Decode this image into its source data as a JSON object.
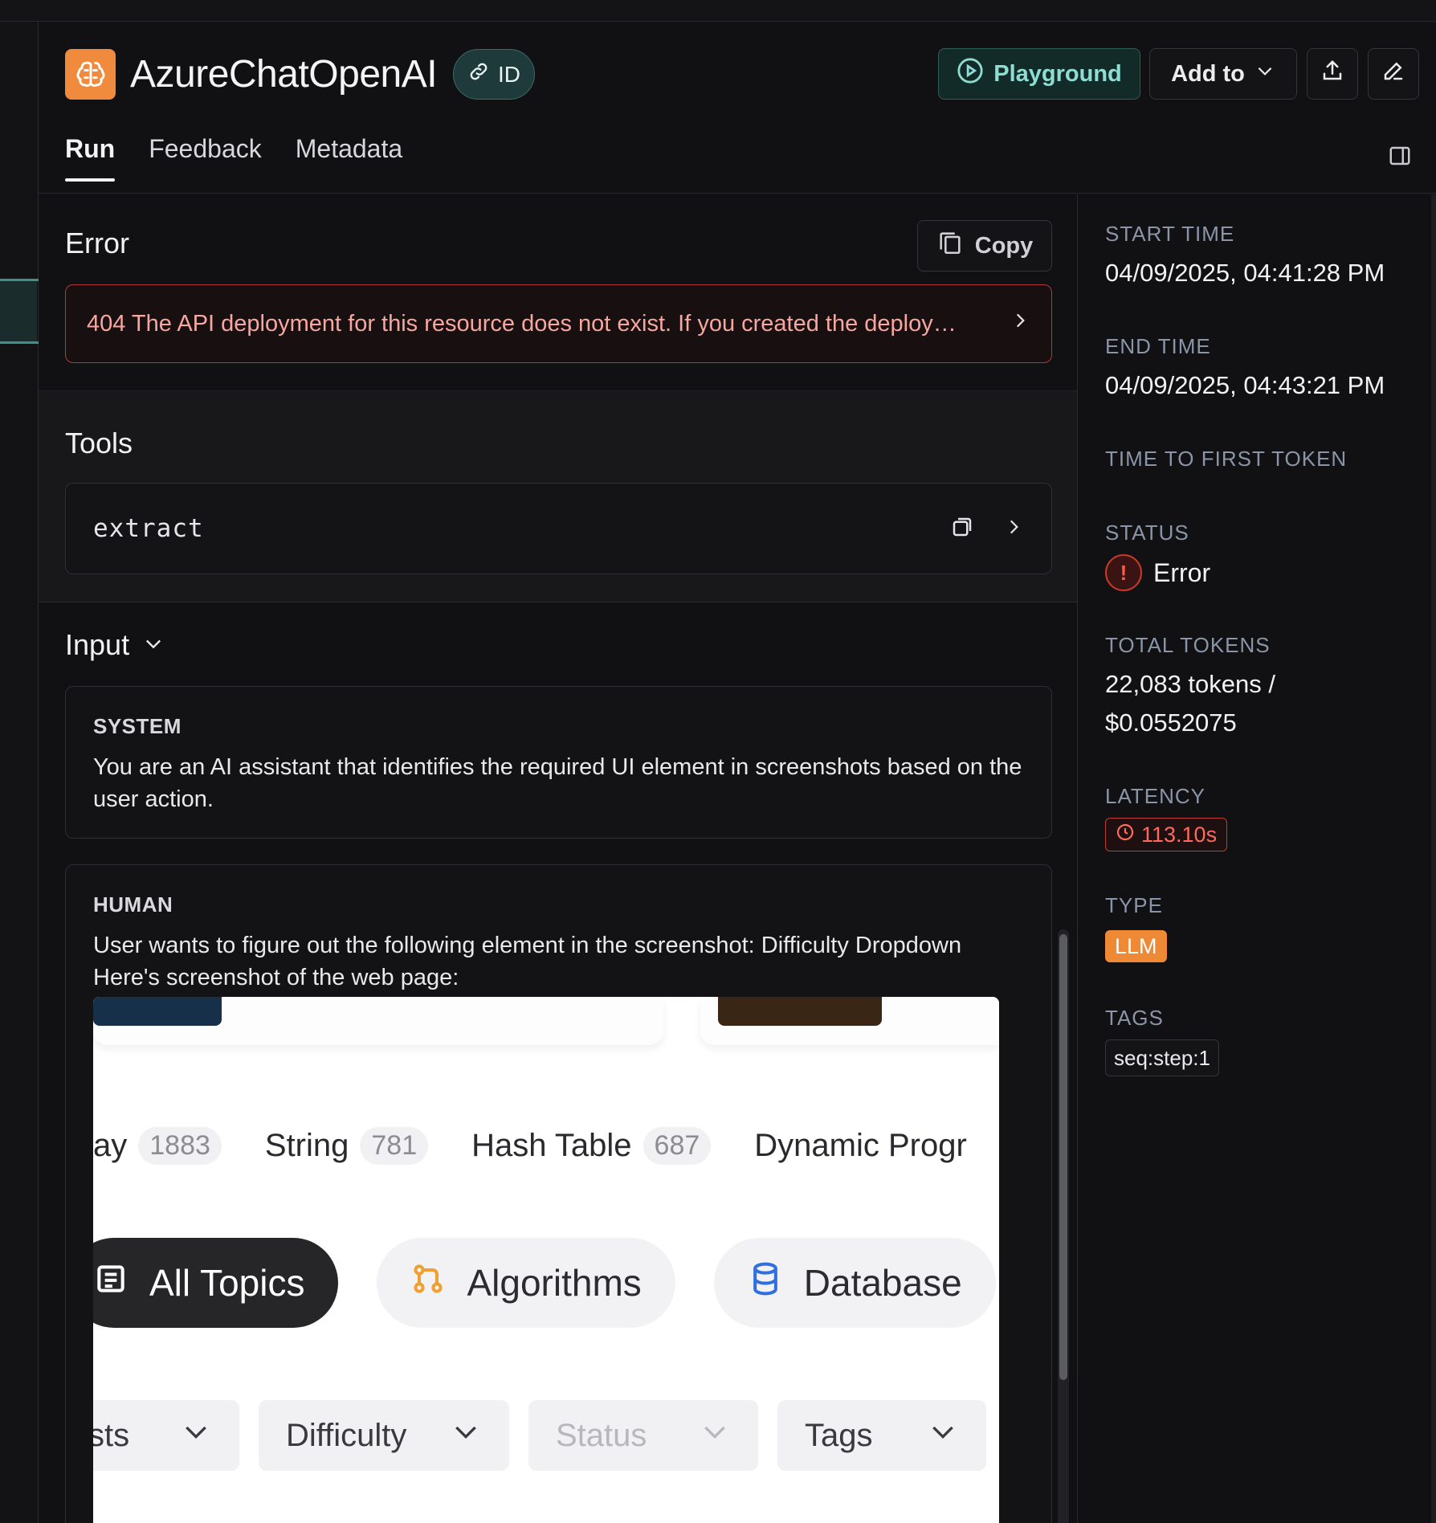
{
  "app": {
    "title": "AzureChatOpenAI",
    "id_label": "ID",
    "colors": {
      "accent": "#f08a3c",
      "teal": "#8fdcd3",
      "error": "#c9392b"
    }
  },
  "toolbar": {
    "playground_label": "Playground",
    "add_to_label": "Add to"
  },
  "tabs": [
    {
      "label": "Run",
      "active": true
    },
    {
      "label": "Feedback",
      "active": false
    },
    {
      "label": "Metadata",
      "active": false
    }
  ],
  "error_section": {
    "title": "Error",
    "copy_label": "Copy",
    "message": "404 The API deployment for this resource does not exist. If you created the deploy…"
  },
  "tools_section": {
    "title": "Tools",
    "items": [
      {
        "name": "extract"
      }
    ]
  },
  "input_section": {
    "title": "Input",
    "system": {
      "role": "SYSTEM",
      "text": "You are an AI assistant that identifies the required UI element in screenshots based on the user action."
    },
    "human": {
      "role": "HUMAN",
      "text_line1": "User wants to figure out the following element in the screenshot: Difficulty Dropdown",
      "text_line2": "Here's screenshot of the web page:",
      "screenshot": {
        "topics": [
          {
            "label": "ay",
            "count": "1883"
          },
          {
            "label": "String",
            "count": "781"
          },
          {
            "label": "Hash Table",
            "count": "687"
          },
          {
            "label": "Dynamic Progr",
            "count": ""
          }
        ],
        "pills": [
          {
            "label": "All Topics",
            "icon": "list-icon"
          },
          {
            "label": "Algorithms",
            "icon": "branch-icon"
          },
          {
            "label": "Database",
            "icon": "database-icon"
          }
        ],
        "filters": [
          {
            "label": "sts"
          },
          {
            "label": "Difficulty"
          },
          {
            "label": "Status"
          },
          {
            "label": "Tags"
          }
        ]
      }
    }
  },
  "details": {
    "start_time_label": "START TIME",
    "start_time": "04/09/2025, 04:41:28 PM",
    "end_time_label": "END TIME",
    "end_time": "04/09/2025, 04:43:21 PM",
    "ttft_label": "TIME TO FIRST TOKEN",
    "status_label": "STATUS",
    "status": "Error",
    "tokens_label": "TOTAL TOKENS",
    "tokens_line1": "22,083 tokens /",
    "tokens_line2": "$0.0552075",
    "latency_label": "LATENCY",
    "latency": "113.10s",
    "type_label": "TYPE",
    "type": "LLM",
    "tags_label": "TAGS",
    "tags": [
      "seq:step:1"
    ]
  }
}
